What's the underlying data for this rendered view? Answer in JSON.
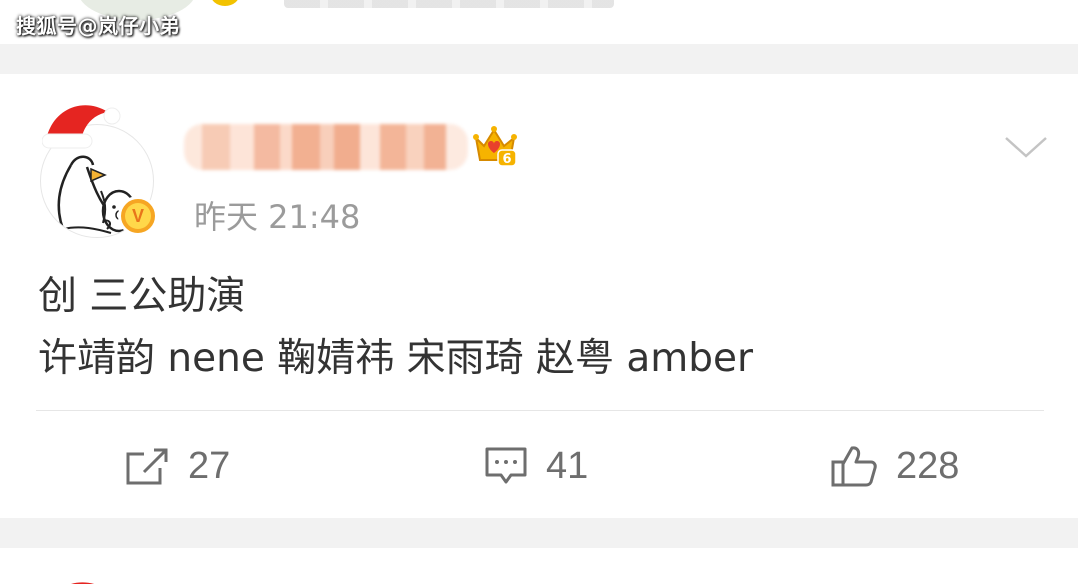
{
  "watermark": "搜狐号@岚仔小弟",
  "post": {
    "username": "",
    "vip_level": "6",
    "verified_label": "V",
    "timestamp": "昨天 21:48",
    "content_lines": [
      "创 三公助演",
      "许靖韵 nene 鞠婧祎 宋雨琦 赵粤 amber"
    ],
    "actions": {
      "share_count": "27",
      "comment_count": "41",
      "like_count": "228"
    }
  },
  "icons": {
    "share": "share-icon",
    "comment": "comment-icon",
    "like": "thumbs-up-icon",
    "dropdown": "chevron-down-icon",
    "vip": "crown-badge-icon"
  },
  "colors": {
    "page_bg": "#f2f2f2",
    "card_bg": "#ffffff",
    "text": "#333333",
    "meta": "#9b9b9b",
    "action": "#6e6e6e",
    "vip_gold": "#f6b300",
    "vip_red": "#e8412c"
  }
}
